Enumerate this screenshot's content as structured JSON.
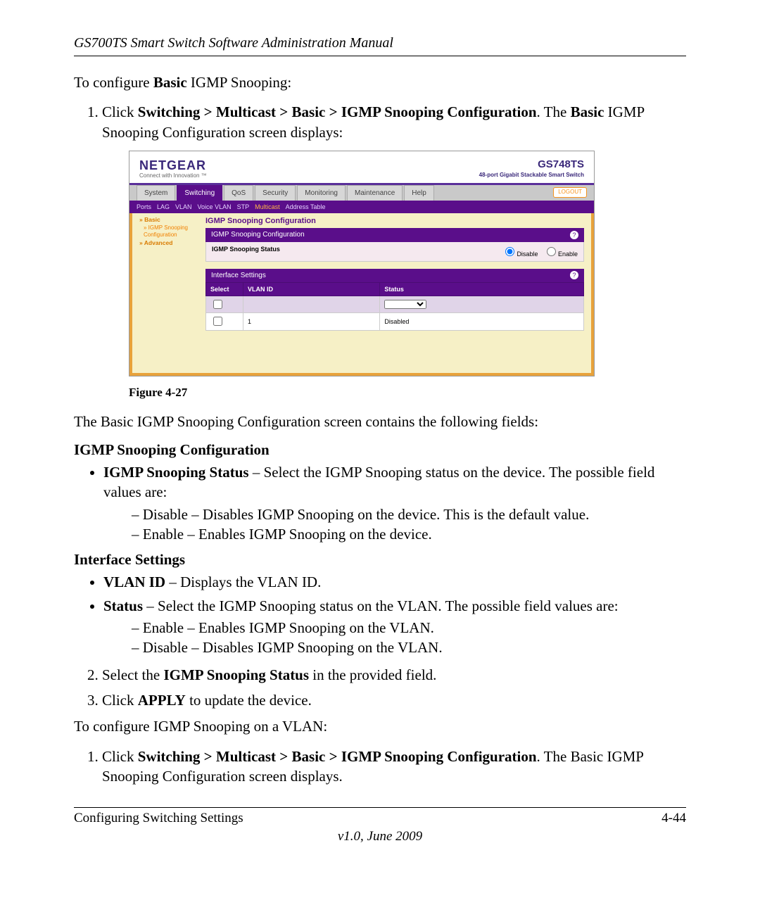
{
  "header": {
    "doc_title": "GS700TS Smart Switch Software Administration Manual"
  },
  "intro": {
    "line1_a": "To configure ",
    "line1_b": "Basic",
    "line1_c": " IGMP Snooping:",
    "step1_a": "Click ",
    "step1_b": "Switching > Multicast > Basic > IGMP Snooping Configuration",
    "step1_c": ". The ",
    "step1_d": "Basic",
    "step1_e": " IGMP Snooping Configuration screen displays:"
  },
  "mock": {
    "logo": "NETGEAR",
    "tagline": "Connect with Innovation ™",
    "product_name": "GS748TS",
    "product_desc": "48-port Gigabit Stackable Smart Switch",
    "tabs": {
      "system": "System",
      "switching": "Switching",
      "qos": "QoS",
      "security": "Security",
      "monitoring": "Monitoring",
      "maintenance": "Maintenance",
      "help": "Help"
    },
    "logout": "LOGOUT",
    "subtabs": {
      "ports": "Ports",
      "lag": "LAG",
      "vlan": "VLAN",
      "voicevlan": "Voice VLAN",
      "stp": "STP",
      "multicast": "Multicast",
      "addr": "Address Table"
    },
    "side": {
      "basic": "» Basic",
      "conf": "» IGMP Snooping\n  Configuration",
      "adv": "» Advanced"
    },
    "panel_title": "IGMP Snooping Configuration",
    "panel1_head": "IGMP Snooping Configuration",
    "panel1_label": "IGMP Snooping Status",
    "disable": "Disable",
    "enable": "Enable",
    "panel2_head": "Interface Settings",
    "th_select": "Select",
    "th_vlan": "VLAN ID",
    "th_status": "Status",
    "row_vlan": "1",
    "row_status": "Disabled"
  },
  "figcap": "Figure 4-27",
  "desc": {
    "lead": "The Basic IGMP Snooping Configuration screen contains the following fields:",
    "sub1": "IGMP Snooping Configuration",
    "b1_t": "IGMP Snooping Status",
    "b1_r": " – Select the IGMP Snooping status on the device. The possible field values are:",
    "d1": "Disable – Disables IGMP Snooping on the device. This is the default value.",
    "d2": "Enable – Enables IGMP Snooping on the device.",
    "sub2": "Interface Settings",
    "b2_t": "VLAN ID",
    "b2_r": " – Displays the VLAN ID.",
    "b3_t": "Status",
    "b3_r": " – Select the IGMP Snooping status on the VLAN. The possible field values are:",
    "d3": "Enable – Enables IGMP Snooping on the VLAN.",
    "d4": "Disable – Disables IGMP Snooping on the VLAN.",
    "step2_a": "Select the ",
    "step2_b": "IGMP Snooping Status",
    "step2_c": " in the provided field.",
    "step3_a": "Click ",
    "step3_b": "APPLY",
    "step3_c": " to update the device.",
    "line2": "To configure IGMP Snooping on a VLAN:",
    "step4_a": "Click ",
    "step4_b": "Switching > Multicast > Basic > IGMP Snooping Configuration",
    "step4_c": ". The Basic IGMP Snooping Configuration screen displays."
  },
  "footer": {
    "left": "Configuring Switching Settings",
    "right": "4-44",
    "version": "v1.0, June 2009"
  }
}
